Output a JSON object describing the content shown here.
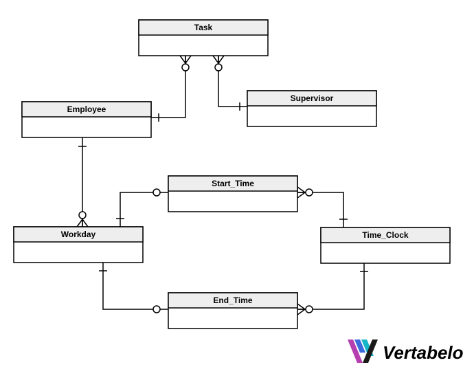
{
  "diagram": {
    "entities": {
      "task": {
        "label": "Task"
      },
      "employee": {
        "label": "Employee"
      },
      "supervisor": {
        "label": "Supervisor"
      },
      "start_time": {
        "label": "Start_Time"
      },
      "workday": {
        "label": "Workday"
      },
      "time_clock": {
        "label": "Time_Clock"
      },
      "end_time": {
        "label": "End_Time"
      }
    },
    "relationships": [
      {
        "from": "employee",
        "to": "task",
        "from_card": "one-mandatory",
        "to_card": "many-optional"
      },
      {
        "from": "supervisor",
        "to": "task",
        "from_card": "one-mandatory",
        "to_card": "many-optional"
      },
      {
        "from": "employee",
        "to": "workday",
        "from_card": "one-mandatory",
        "to_card": "many-optional"
      },
      {
        "from": "workday",
        "to": "start_time",
        "from_card": "one-mandatory",
        "to_card": "one-optional"
      },
      {
        "from": "workday",
        "to": "end_time",
        "from_card": "one-mandatory",
        "to_card": "one-optional"
      },
      {
        "from": "time_clock",
        "to": "start_time",
        "from_card": "one-mandatory",
        "to_card": "many-optional"
      },
      {
        "from": "time_clock",
        "to": "end_time",
        "from_card": "one-mandatory",
        "to_card": "many-optional"
      }
    ]
  },
  "branding": {
    "name": "Vertabelo"
  }
}
